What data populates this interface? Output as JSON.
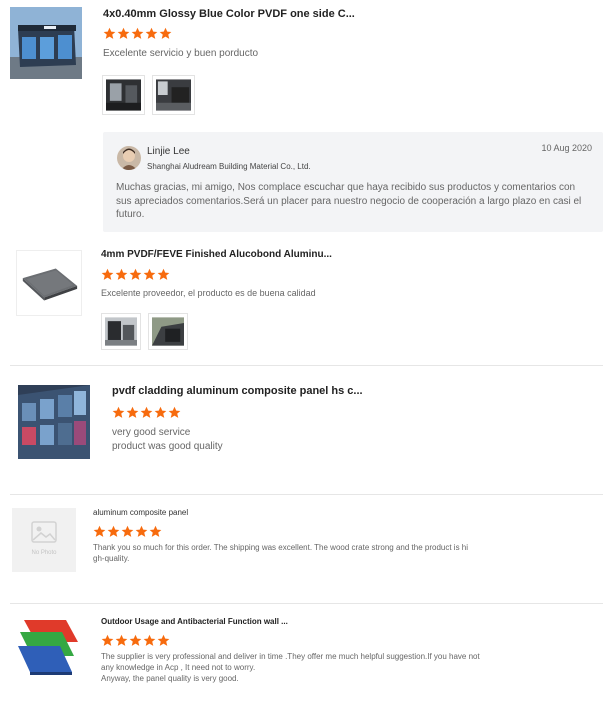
{
  "reviews": [
    {
      "title": "4x0.40mm Glossy Blue Color PVDF one side C...",
      "rating": 5,
      "comment": [
        "Excelente servicio y buen porducto"
      ],
      "thumb_icon": "building-storefront-image",
      "photos": [
        "interior-photo-1",
        "interior-photo-2"
      ],
      "reply": {
        "name": "Linjie Lee",
        "company": "Shanghai Aludream Building Material Co., Ltd.",
        "date": "10 Aug 2020",
        "text": "Muchas gracias, mi amigo, Nos complace escuchar que haya recibido sus productos y comentarios con sus apreciados comentarios.Será un placer para nuestro negocio de cooperación a largo plazo en casi el futuro."
      }
    },
    {
      "title": "4mm PVDF/FEVE Finished Alucobond Aluminu...",
      "rating": 5,
      "comment": [
        "Excelente proveedor, el producto es de buena calidad"
      ],
      "thumb_icon": "panel-image",
      "photos": [
        "site-photo-1",
        "site-photo-2"
      ]
    },
    {
      "title": "pvdf cladding aluminum composite panel hs c...",
      "rating": 5,
      "comment": [
        "very good service",
        "product was good quality"
      ],
      "thumb_icon": "facade-image"
    },
    {
      "title": "aluminum composite panel",
      "rating": 5,
      "comment": [
        "Thank you so much for this order.  The shipping was excellent.  The wood crate strong and the product is hi",
        "gh-quality."
      ],
      "thumb_icon": "no-photo-placeholder",
      "no_photo_label": "No Photo"
    },
    {
      "title": "Outdoor Usage and Antibacterial Function wall ...",
      "rating": 5,
      "comment": [
        "The supplier is very professional and deliver in time .They offer me much helpful suggestion.If you have not",
        "any knowledge in Acp , It need not to worry.",
        "Anyway, the panel quality is very good."
      ],
      "thumb_icon": "color-panels-image"
    }
  ],
  "colors": {
    "star": "#f76b0e",
    "reply_bg": "#f3f4f6",
    "divider": "#e6e6e6"
  }
}
